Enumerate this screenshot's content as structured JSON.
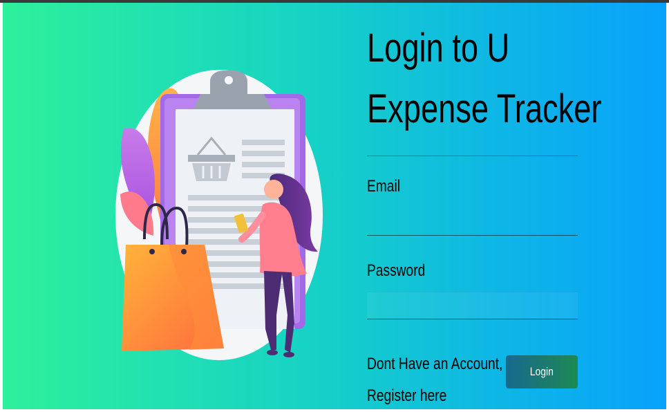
{
  "login": {
    "title_line1": "Login to U",
    "title_line2": "Expense Tracker",
    "email_label": "Email",
    "email_value": "",
    "password_label": "Password",
    "password_value": "",
    "register_line1": "Dont Have an Account,",
    "register_line2": "Register here",
    "login_button": "Login"
  },
  "illustration": {
    "icon": "shopping-checklist-illustration"
  },
  "colors": {
    "gradient_start": "#2ef09b",
    "gradient_end": "#08a2fb",
    "button_start": "#176a8e",
    "button_end": "#1c8a53"
  }
}
